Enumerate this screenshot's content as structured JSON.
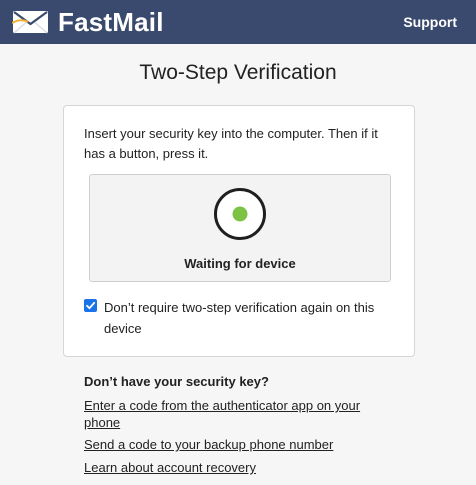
{
  "header": {
    "brand_name": "FastMail",
    "support_label": "Support",
    "brand_color": "#3a4a6e",
    "logo_icon": "envelope-icon"
  },
  "page": {
    "title": "Two-Step Verification"
  },
  "panel": {
    "instructions": "Insert your security key into the computer. Then if it has a button, press it.",
    "device_status": "Waiting for device",
    "status_icon": "waiting-indicator-icon",
    "status_color": "#7dc243",
    "remember_label": "Don’t require two-step verification again on this device",
    "remember_checked": true
  },
  "alternatives": {
    "title": "Don’t have your security key?",
    "links": [
      "Enter a code from the authenticator app on your phone",
      "Send a code to your backup phone number",
      "Learn about account recovery"
    ]
  }
}
